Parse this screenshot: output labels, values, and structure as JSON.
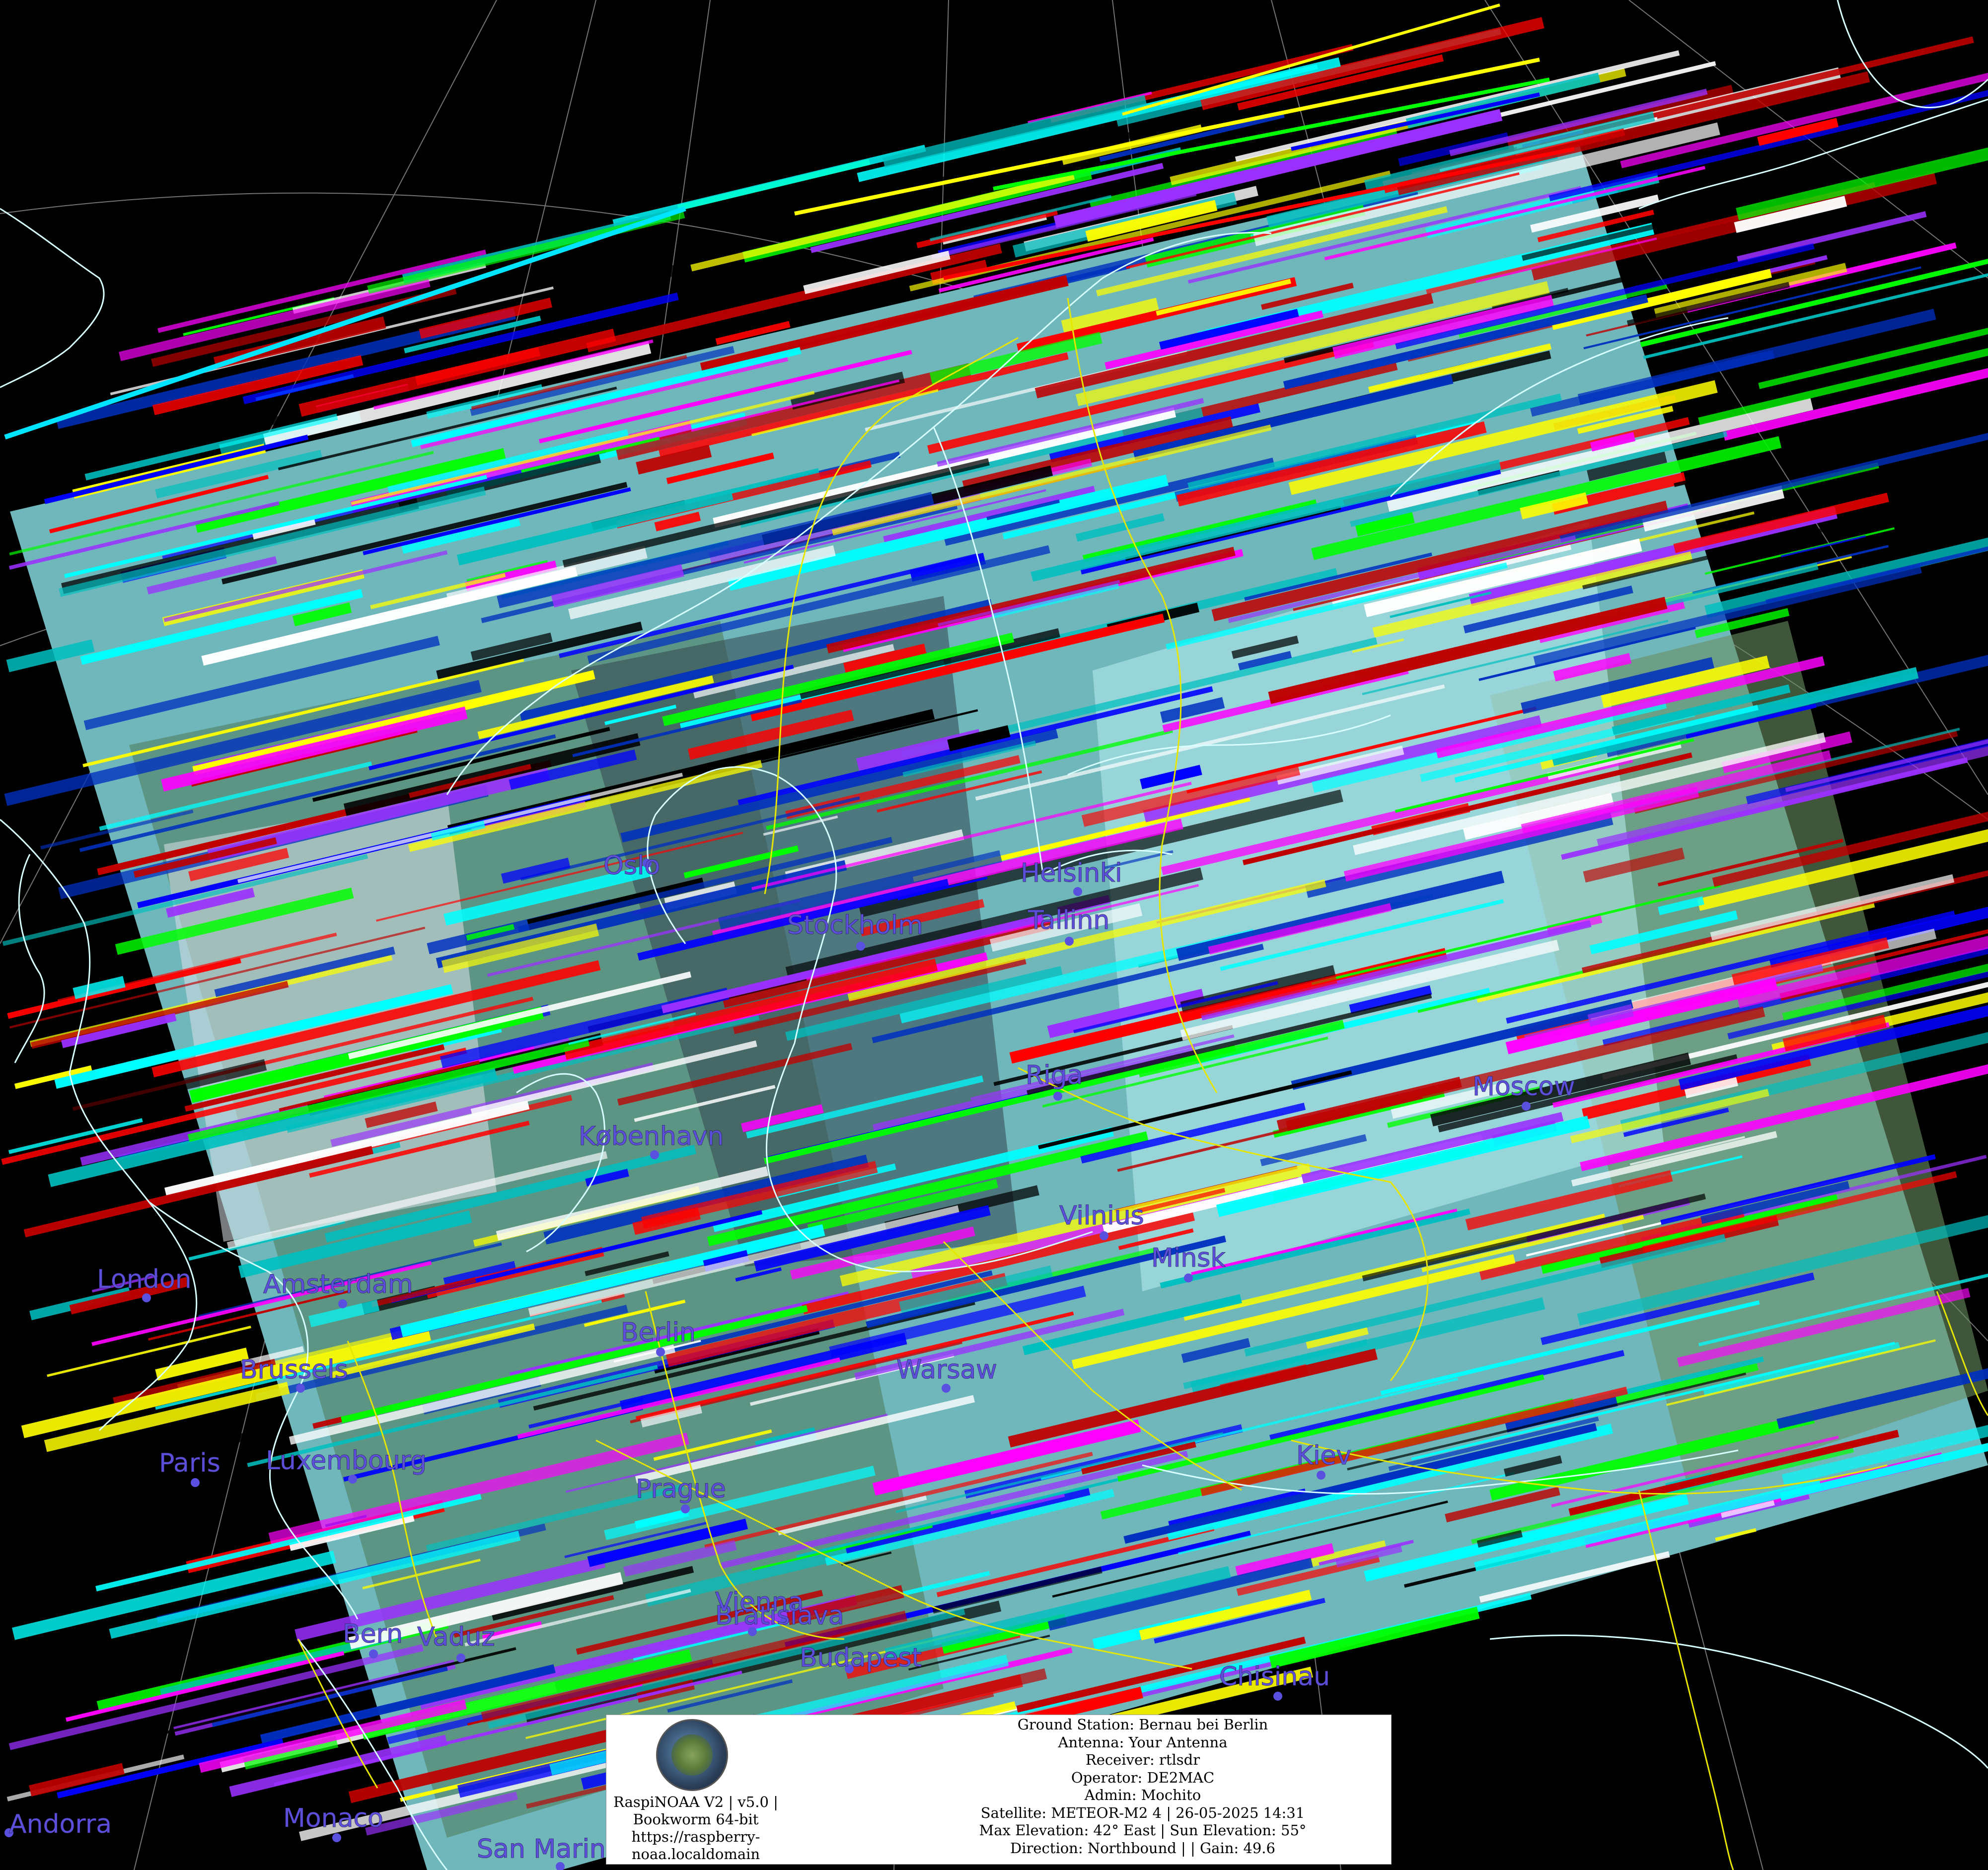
{
  "cities": [
    {
      "name": "Oslo"
    },
    {
      "name": "Stockholm"
    },
    {
      "name": "Helsinki"
    },
    {
      "name": "Tallinn"
    },
    {
      "name": "Riga"
    },
    {
      "name": "Moscow"
    },
    {
      "name": "København"
    },
    {
      "name": "Vilnius"
    },
    {
      "name": "Minsk"
    },
    {
      "name": "London"
    },
    {
      "name": "Amsterdam"
    },
    {
      "name": "Berlin"
    },
    {
      "name": "Brussels"
    },
    {
      "name": "Warsaw"
    },
    {
      "name": "Paris"
    },
    {
      "name": "Luxembourg"
    },
    {
      "name": "Kiev"
    },
    {
      "name": "Prague"
    },
    {
      "name": "Bern"
    },
    {
      "name": "Vaduz"
    },
    {
      "name": "Bratislava"
    },
    {
      "name": "Vienna"
    },
    {
      "name": "Budapest"
    },
    {
      "name": "Chisinau"
    },
    {
      "name": "Andorra"
    },
    {
      "name": "Monaco"
    },
    {
      "name": "San Marino"
    }
  ],
  "info_box": {
    "left_lines": [
      "RaspiNOAA V2 | v5.0 |",
      "Bookworm 64-bit",
      "https://raspberry-",
      "noaa.localdomain"
    ],
    "right_lines": [
      "Ground Station: Bernau bei Berlin",
      "Antenna: Your Antenna",
      "Receiver: rtlsdr",
      "Operator: DE2MAC",
      "Admin: Mochito",
      "Satellite: METEOR-M2 4 | 26-05-2025 14:31",
      "Max Elevation: 42° East | Sun Elevation: 55°",
      "Direction: Northbound | | Gain: 49.6"
    ]
  },
  "colors": {
    "background": "#000000",
    "coastline": "#d8ffff",
    "borders": "#e6e600",
    "graticule": "#9a9a9a",
    "city_label": "#5b4fd9",
    "noise_palette": [
      "#ff0000",
      "#00ff00",
      "#0000ff",
      "#00ffff",
      "#ff00ff",
      "#ffff00",
      "#9b30ff",
      "#c00000",
      "#0030c0",
      "#00c0c0",
      "#ffffff",
      "#000000"
    ]
  }
}
